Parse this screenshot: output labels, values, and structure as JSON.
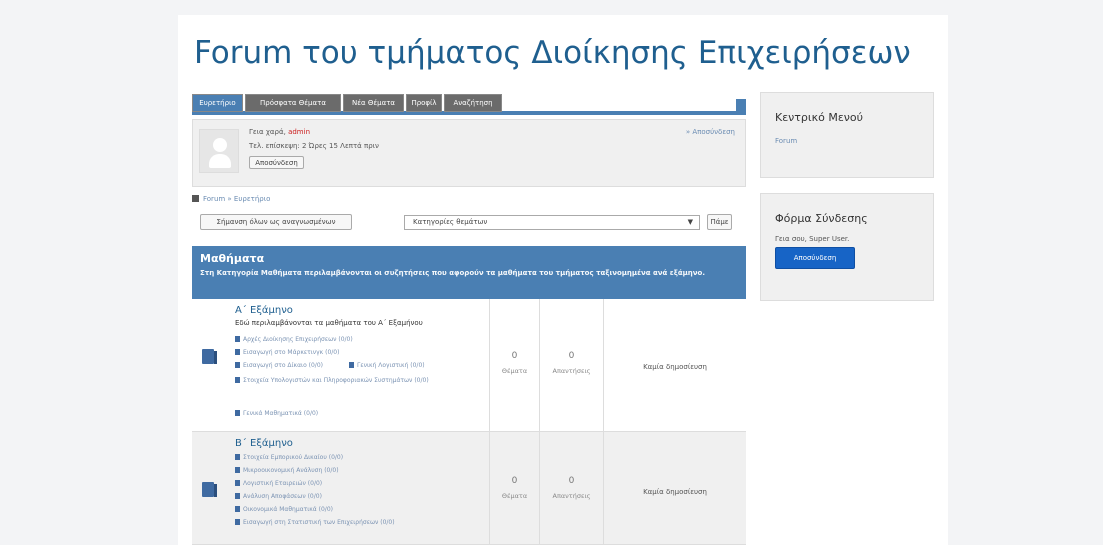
{
  "site": {
    "title": "Forum του τμήματος Διοίκησης Επιχειρήσεων"
  },
  "tabs": [
    {
      "label": "Ευρετήριο",
      "active": true
    },
    {
      "label": "Πρόσφατα Θέματα"
    },
    {
      "label": "Νέα Θέματα"
    },
    {
      "label": "Προφίλ"
    },
    {
      "label": "Αναζήτηση"
    }
  ],
  "user": {
    "greeting": "Γεια χαρά,",
    "username": "admin",
    "last_visit": "Τελ. επίσκεψη: 2 Ώρες 15 Λεπτά πριν",
    "logout_button": "Αποσύνδεση",
    "logout_link": "» Αποσύνδεση"
  },
  "breadcrumb": "Forum » Ευρετήριο",
  "toolbar": {
    "mark_all_read": "Σήμανση όλων ως αναγνωσμένων",
    "category_select": "Κατηγορίες θεμάτων",
    "go_button": "Πάμε"
  },
  "category": {
    "name": "Μαθήματα",
    "description": "Στη Κατηγορία Μαθήματα περιλαμβάνονται οι συζητήσεις που αφορούν τα μαθήματα του τμήματος ταξινομημένα ανά εξάμηνο."
  },
  "forums": [
    {
      "title": "Α΄ Εξάμηνο",
      "description": "Εδώ περιλαμβάνονται τα μαθήματα του Α΄ Εξαμήνου",
      "subforums": [
        "Αρχές Διοίκησης Επιχειρήσεων (0/0)",
        "Εισαγωγή στο Μάρκετινγκ (0/0)",
        "Εισαγωγή στο Δίκαιο (0/0)",
        "Γενική Λογιστική (0/0)",
        "Στοιχεία Υπολογιστών και Πληροφοριακών Συστημάτων (0/0)",
        "Γενικά Μαθηματικά (0/0)"
      ],
      "topics": "0",
      "topics_label": "Θέματα",
      "replies": "0",
      "replies_label": "Απαντήσεις",
      "last_post": "Καμία δημοσίευση"
    },
    {
      "title": "Β΄ Εξάμηνο",
      "subforums": [
        "Στοιχεία Εμπορικού Δικαίου (0/0)",
        "Μικροοικονομική Ανάλυση (0/0)",
        "Λογιστική Εταιρειών (0/0)",
        "Ανάλυση Αποφάσεων (0/0)",
        "Οικονομικά Μαθηματικά (0/0)",
        "Εισαγωγή στη Στατιστική των Επιχειρήσεων (0/0)"
      ],
      "topics": "0",
      "topics_label": "Θέματα",
      "replies": "0",
      "replies_label": "Απαντήσεις",
      "last_post": "Καμία δημοσίευση"
    }
  ],
  "sidebar": {
    "main_menu": {
      "title": "Κεντρικό Μενού",
      "link": "Forum"
    },
    "login_form": {
      "title": "Φόρμα Σύνδεσης",
      "hello": "Γεια σου, Super User.",
      "logout_button": "Αποσύνδεση"
    }
  },
  "colors": {
    "accent": "#4a7fb3",
    "title": "#1f5f8f",
    "logout_button": "#1764c6"
  }
}
